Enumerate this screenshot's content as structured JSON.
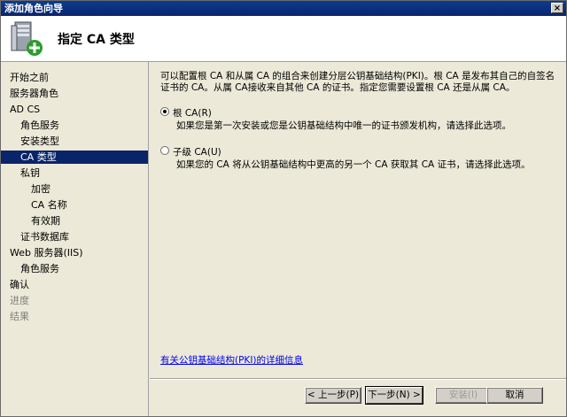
{
  "window": {
    "title": "添加角色向导",
    "close_glyph": "×"
  },
  "header": {
    "title": "指定 CA 类型",
    "icon": "server-add-icon"
  },
  "sidebar": {
    "items": [
      {
        "label": "开始之前",
        "indent": 0,
        "state": "normal"
      },
      {
        "label": "服务器角色",
        "indent": 0,
        "state": "normal"
      },
      {
        "label": "AD CS",
        "indent": 0,
        "state": "normal"
      },
      {
        "label": "角色服务",
        "indent": 1,
        "state": "normal"
      },
      {
        "label": "安装类型",
        "indent": 1,
        "state": "normal"
      },
      {
        "label": "CA 类型",
        "indent": 1,
        "state": "selected"
      },
      {
        "label": "私钥",
        "indent": 1,
        "state": "normal"
      },
      {
        "label": "加密",
        "indent": 2,
        "state": "normal"
      },
      {
        "label": "CA 名称",
        "indent": 2,
        "state": "normal"
      },
      {
        "label": "有效期",
        "indent": 2,
        "state": "normal"
      },
      {
        "label": "证书数据库",
        "indent": 1,
        "state": "normal"
      },
      {
        "label": "Web 服务器(IIS)",
        "indent": 0,
        "state": "normal"
      },
      {
        "label": "角色服务",
        "indent": 1,
        "state": "normal"
      },
      {
        "label": "确认",
        "indent": 0,
        "state": "normal"
      },
      {
        "label": "进度",
        "indent": 0,
        "state": "disabled"
      },
      {
        "label": "结果",
        "indent": 0,
        "state": "disabled"
      }
    ]
  },
  "content": {
    "intro": "可以配置根 CA 和从属 CA 的组合来创建分层公钥基础结构(PKI)。根 CA 是发布其自己的自签名证书的 CA。从属 CA接收来自其他 CA 的证书。指定您需要设置根 CA 还是从属 CA。",
    "options": [
      {
        "label": "根 CA(R)",
        "description": "如果您是第一次安装或您是公钥基础结构中唯一的证书颁发机构，请选择此选项。",
        "selected": true
      },
      {
        "label": "子级 CA(U)",
        "description": "如果您的 CA 将从公钥基础结构中更高的另一个 CA 获取其 CA 证书，请选择此选项。",
        "selected": false
      }
    ],
    "link": "有关公钥基础结构(PKI)的详细信息"
  },
  "buttons": {
    "prev": "< 上一步(P)",
    "next": "下一步(N) >",
    "install": "安装(I)",
    "cancel": "取消"
  }
}
